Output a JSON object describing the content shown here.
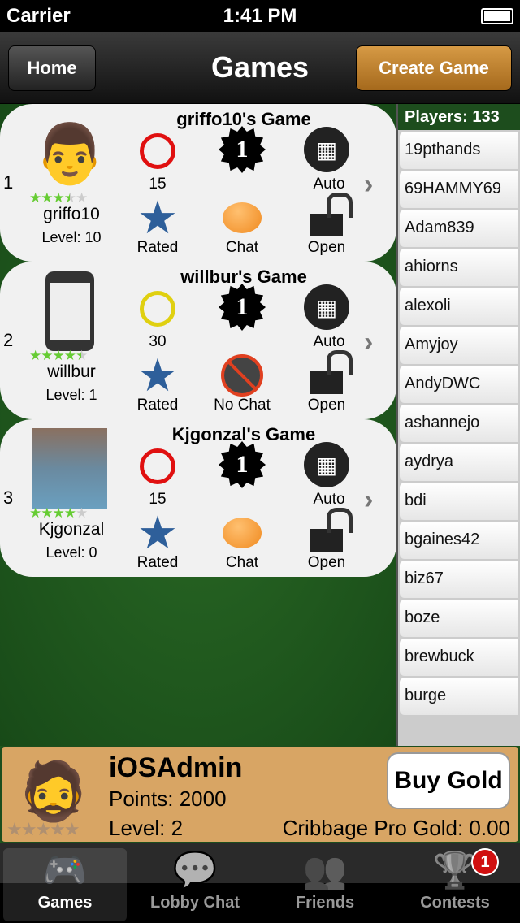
{
  "status": {
    "carrier": "Carrier",
    "time": "1:41 PM"
  },
  "nav": {
    "title": "Games",
    "home": "Home",
    "create": "Create Game"
  },
  "games": [
    {
      "index": "1",
      "title": "griffo10's Game",
      "user": "griffo10",
      "level": "Level: 10",
      "rating": 3.5,
      "avatar": "cartoon-face",
      "timer": "15",
      "timer_color": "#e01010",
      "best_of": "1",
      "scoring": "Auto",
      "rated": "Rated",
      "chat": "Chat",
      "chat_enabled": true,
      "status": "Open"
    },
    {
      "index": "2",
      "title": "willbur's Game",
      "user": "willbur",
      "level": "Level: 1",
      "rating": 4.5,
      "avatar": "phone",
      "timer": "30",
      "timer_color": "#e0d010",
      "best_of": "1",
      "scoring": "Auto",
      "rated": "Rated",
      "chat": "No Chat",
      "chat_enabled": false,
      "status": "Open"
    },
    {
      "index": "3",
      "title": "Kjgonzal's Game",
      "user": "Kjgonzal",
      "level": "Level: 0",
      "rating": 4,
      "avatar": "photo",
      "timer": "15",
      "timer_color": "#e01010",
      "best_of": "1",
      "scoring": "Auto",
      "rated": "Rated",
      "chat": "Chat",
      "chat_enabled": true,
      "status": "Open"
    }
  ],
  "players": {
    "header": "Players: 133",
    "list": [
      "19pthands",
      "69HAMMY69",
      "Adam839",
      "ahiorns",
      "alexoli",
      "Amyjoy",
      "AndyDWC",
      "ashannejo",
      "aydrya",
      "bdi",
      "bgaines42",
      "biz67",
      "boze",
      "brewbuck",
      "burge"
    ]
  },
  "me": {
    "name": "iOSAdmin",
    "points": "Points: 2000",
    "level": "Level: 2",
    "gold": "Cribbage Pro Gold: 0.00",
    "buy": "Buy Gold",
    "rating": 0
  },
  "tabs": [
    {
      "label": "Games",
      "icon": "gamepad-icon",
      "active": true
    },
    {
      "label": "Lobby Chat",
      "icon": "chat-bubble-icon"
    },
    {
      "label": "Friends",
      "icon": "people-icon"
    },
    {
      "label": "Contests",
      "icon": "trophy-icon",
      "badge": "1"
    }
  ],
  "colors": {
    "create_button": "#c0812f",
    "felt": "#1e5a1e",
    "panel": "#d8a564"
  }
}
